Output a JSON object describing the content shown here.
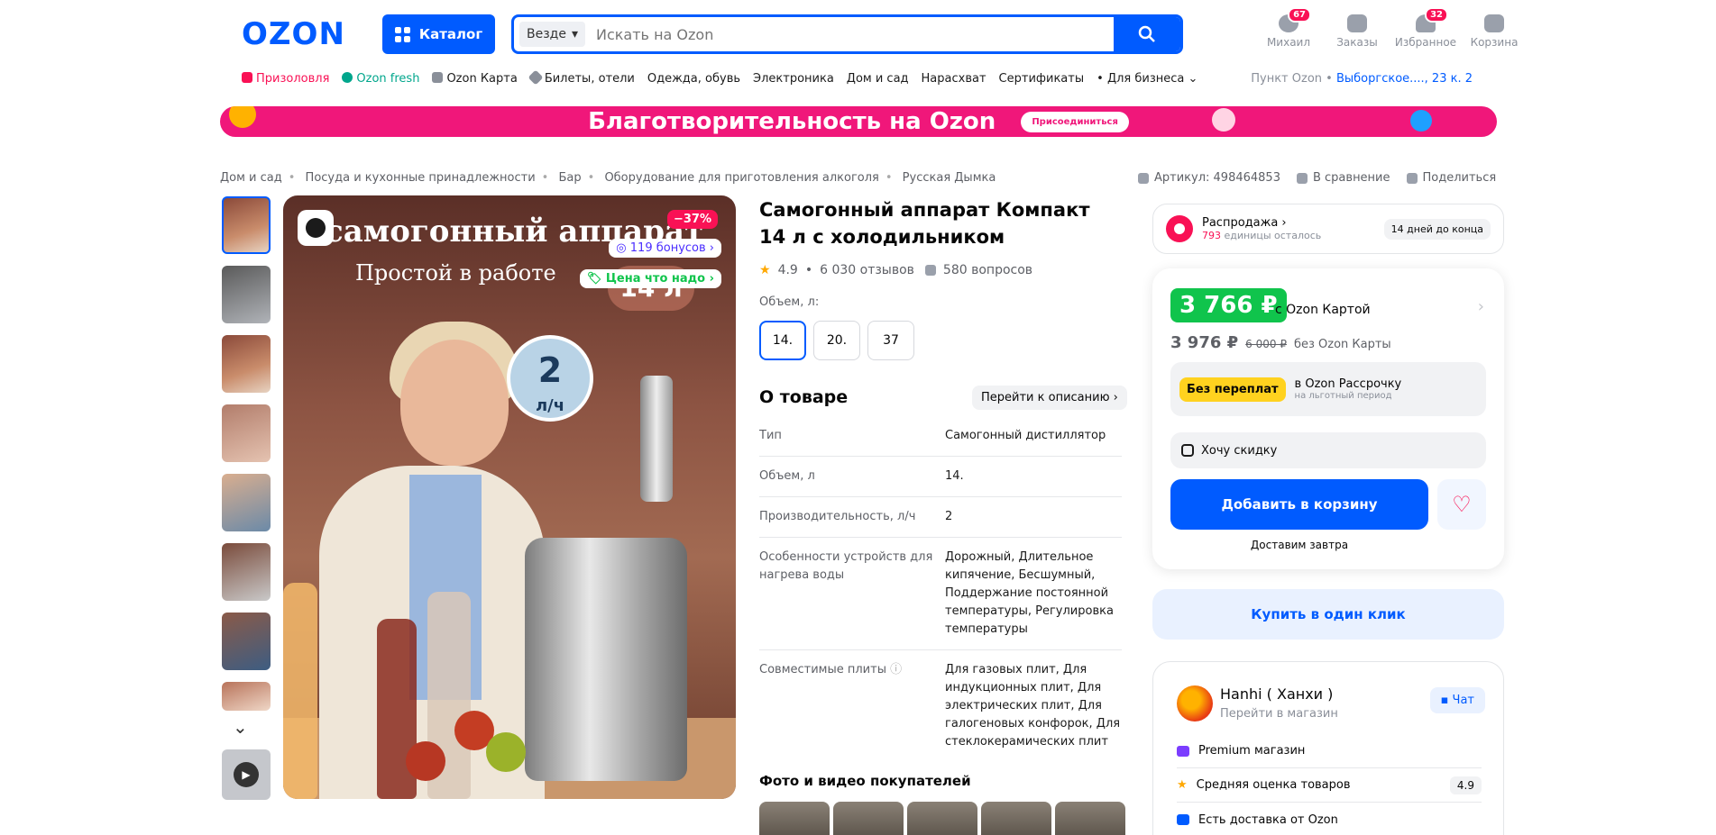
{
  "header": {
    "logo": "OZON",
    "catalog_label": "Каталог",
    "search_scope": "Везде",
    "search_placeholder": "Искать на Ozon",
    "account_label": "Михаил",
    "account_badge": "67",
    "orders_label": "Заказы",
    "favorites_label": "Избранное",
    "favorites_badge": "32",
    "cart_label": "Корзина"
  },
  "nav": {
    "items": [
      "Призоловля",
      "Ozon fresh",
      "Ozon Карта",
      "Билеты, отели",
      "Одежда, обувь",
      "Электроника",
      "Дом и сад",
      "Нарасхват",
      "Сертификаты",
      "Для бизнеса"
    ],
    "pickup_label": "Пункт Ozon •",
    "pickup_address": "Выборгское...., 23 к. 2"
  },
  "banner": {
    "text": "Благотворительность на Ozon",
    "button": "Присоединиться"
  },
  "breadcrumbs": [
    "Дом и сад",
    "Посуда и кухонные принадлежности",
    "Бар",
    "Оборудование для приготовления алкоголя",
    "Русская Дымка"
  ],
  "meta": {
    "article": "Артикул: 498464853",
    "compare": "В сравнение",
    "share": "Поделиться"
  },
  "image": {
    "title": "самогонный аппарат",
    "subtitle": "Простой в работе",
    "volume_text": "14 л",
    "flow_value": "2",
    "flow_unit": "л/ч",
    "discount": "−37%",
    "bonus": "119 бонусов",
    "good_price": "Цена что надо"
  },
  "product": {
    "title": "Самогонный аппарат Компакт 14 л с холодильником",
    "rating": "4.9",
    "reviews": "6 030 отзывов",
    "questions": "580 вопросов",
    "volume_label": "Объем, л:",
    "volumes": [
      "14.",
      "20.",
      "37"
    ],
    "about_title": "О товаре",
    "about_link": "Перейти к описанию",
    "specs": [
      {
        "k": "Тип",
        "v": "Самогонный дистиллятор"
      },
      {
        "k": "Объем, л",
        "v": "14."
      },
      {
        "k": "Производительность, л/ч",
        "v": "2"
      },
      {
        "k": "Особенности устройств для нагрева воды",
        "v": "Дорожный, Длительное кипячение, Бесшумный, Поддержание постоянной температуры, Регулировка температуры"
      },
      {
        "k": "Совместимые плиты",
        "v": "Для газовых плит, Для индукционных плит, Для электрических плит, Для галогеновых конфорок, Для стеклокерамических плит"
      }
    ],
    "photos_title": "Фото и видео покупателей"
  },
  "sale": {
    "title": "Распродажа",
    "count": "793",
    "count_suffix": "единицы осталось",
    "days": "14 дней до конца"
  },
  "price": {
    "card_price": "3 766 ₽",
    "card_note": "с Ozon Картой",
    "regular_price": "3 976 ₽",
    "old_price": "6 000 ₽",
    "regular_note": "без Ozon Карты",
    "installment_tag": "Без переплат",
    "installment_title": "в Ozon Рассрочку",
    "installment_sub": "на льготный период",
    "want_discount": "Хочу скидку",
    "add_to_cart": "Добавить в корзину",
    "delivery": "Доставим завтра",
    "one_click": "Купить в один клик"
  },
  "seller": {
    "name": "Hanhi ( Ханхи )",
    "go": "Перейти в магазин",
    "chat": "Чат",
    "premium": "Premium магазин",
    "avg_rating_label": "Средняя оценка товаров",
    "avg_rating": "4.9",
    "delivery": "Есть доставка от Ozon"
  },
  "colors": {
    "brand": "#005bff",
    "accent_pink": "#f91155",
    "price_green": "#10c44c"
  }
}
